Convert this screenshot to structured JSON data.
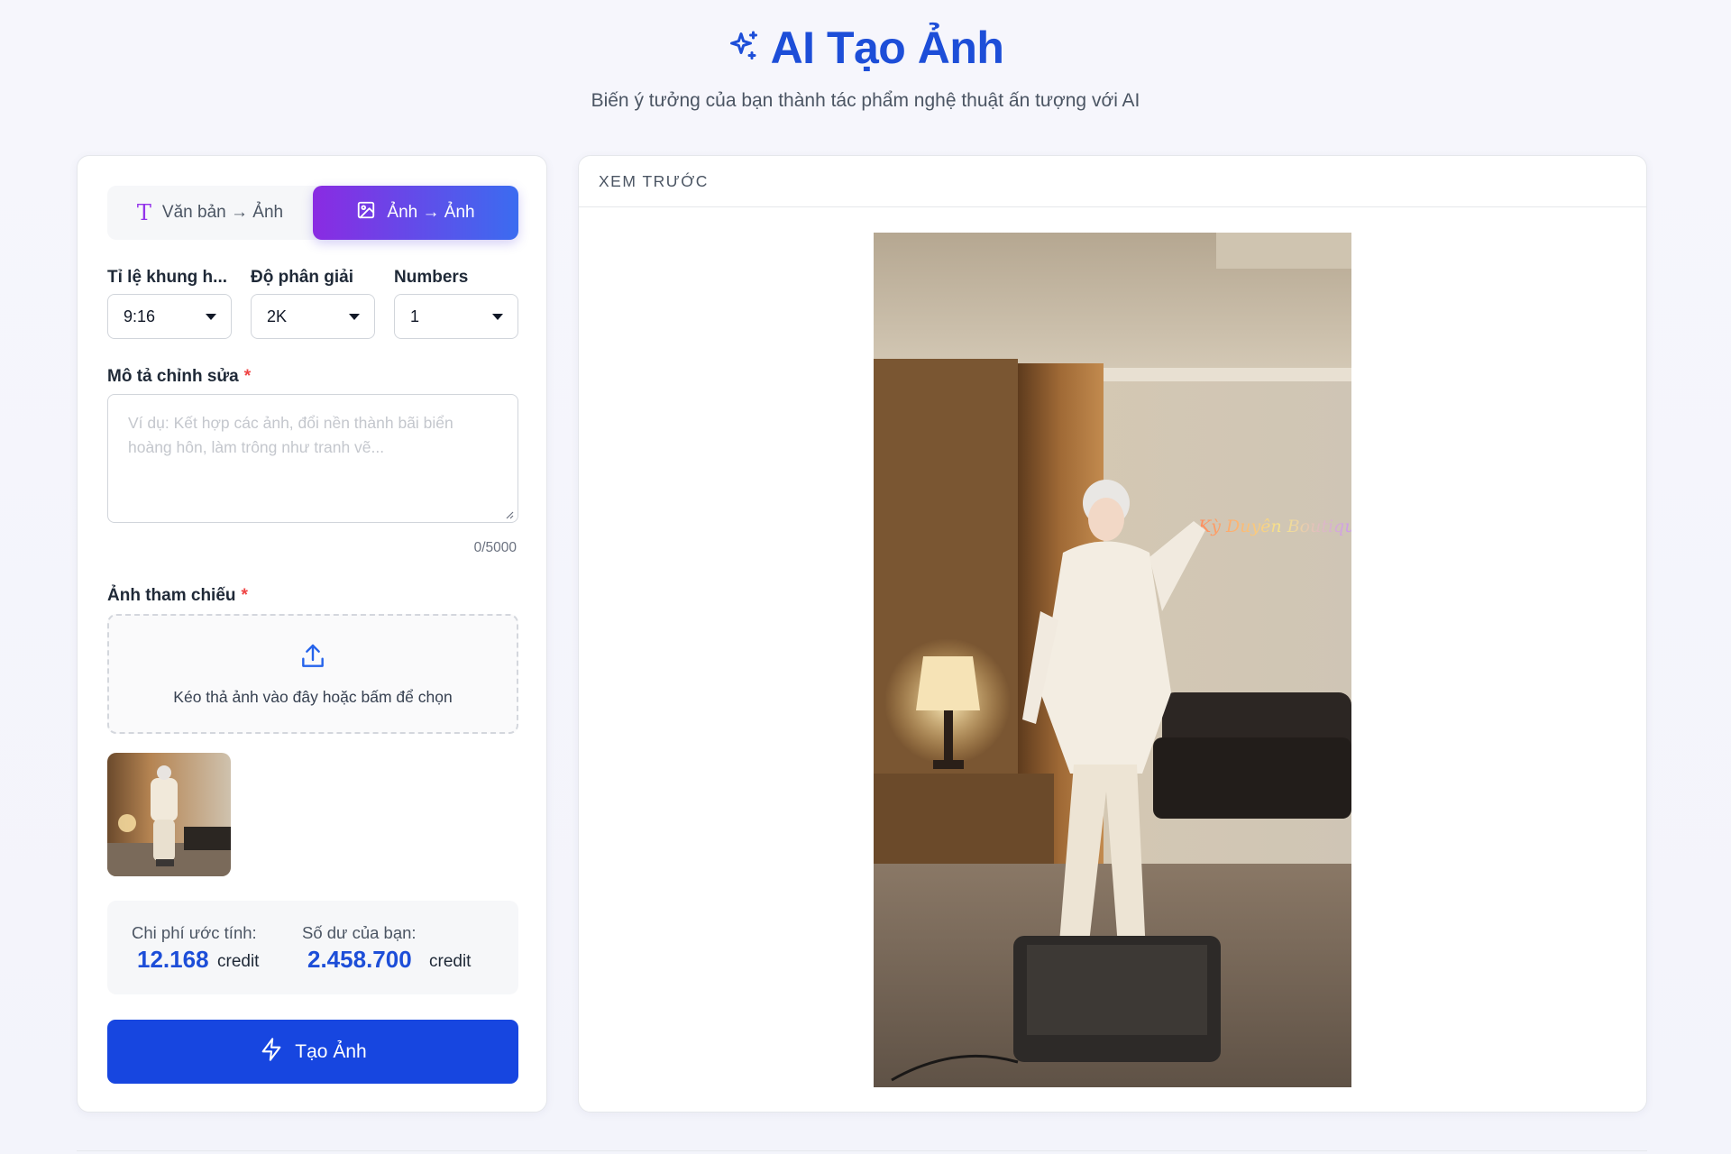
{
  "header": {
    "title": "AI Tạo Ảnh",
    "subtitle": "Biến ý tưởng của bạn thành tác phẩm nghệ thuật ấn tượng với AI"
  },
  "tabs": [
    {
      "label": "Văn bản → Ảnh",
      "icon": "text-t-icon",
      "active": false
    },
    {
      "label": "Ảnh → Ảnh",
      "icon": "image-icon",
      "active": true
    }
  ],
  "selects": {
    "aspect": {
      "label": "Tỉ lệ khung h...",
      "value": "9:16"
    },
    "resolution": {
      "label": "Độ phân giải",
      "value": "2K"
    },
    "numbers": {
      "label": "Numbers",
      "value": "1"
    }
  },
  "prompt": {
    "label": "Mô tả chỉnh sửa",
    "required_mark": "*",
    "placeholder": "Ví dụ: Kết hợp các ảnh, đổi nền thành bãi biển hoàng hôn, làm trông như tranh vẽ...",
    "value": "",
    "counter": "0/5000"
  },
  "reference": {
    "label": "Ảnh tham chiếu",
    "required_mark": "*",
    "dropzone_text": "Kéo thả ảnh vào đây hoặc bấm để chọn"
  },
  "cost": {
    "estimate_label": "Chi phí ước tính:",
    "estimate_value": "12.168",
    "estimate_unit": "credit",
    "balance_label": "Số dư của bạn:",
    "balance_value": "2.458.700",
    "balance_unit": "credit"
  },
  "create_button": {
    "label": "Tạo Ảnh",
    "icon": "lightning-icon"
  },
  "preview": {
    "heading": "XEM TRƯỚC",
    "neon_sign": "Kỳ Duyên Boutique"
  },
  "colors": {
    "brand_blue": "#1d4ed8",
    "button_blue": "#1746e0",
    "tab_gradient_start": "#8a2be2",
    "tab_gradient_end": "#3b6cf0",
    "required_red": "#ef4444"
  }
}
